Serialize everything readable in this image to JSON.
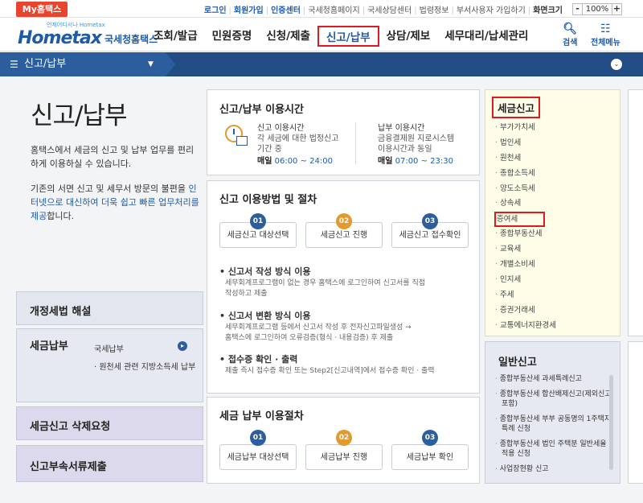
{
  "util": {
    "my_tab": "My홈택스",
    "links_blue": [
      "로그인",
      "회원가입",
      "인증센터"
    ],
    "links": [
      "국세청홈페이지",
      "국세상담센터",
      "법령정보",
      "부서사용자 가입하기",
      "화면크기"
    ],
    "zoom_minus": "-",
    "zoom_value": "100%",
    "zoom_plus": "+"
  },
  "header": {
    "logo_sub": "언제어디서나 Hometax",
    "logo_text": "Hometax",
    "agency": "국세청홈택스",
    "nav": [
      "조회/발급",
      "민원증명",
      "신청/제출",
      "신고/납부",
      "상담/제보",
      "세무대리/납세관리"
    ],
    "active_index": 3,
    "search_label": "검색",
    "menu_label": "전체메뉴"
  },
  "location": {
    "current": "신고/납부"
  },
  "page": {
    "title": "신고/납부",
    "desc1": "홈택스에서 세금의 신고 및 납부 업무를 편리하게 이용하실 수 있습니다.",
    "desc2_pre": "기존의 서면 신고 및 세무서 방문의 불편을 ",
    "desc2_hl": "인터넷으로 대신하여 더욱 쉽고 빠른 업무처리를 제공",
    "desc2_post": "합니다."
  },
  "left_boxes": {
    "law": "개정세법 해설",
    "pay": "세금납부",
    "pay_sub1": "국세납부",
    "pay_sub2": "· 원천세 관련 지방소득세 납부",
    "delete": "세금신고 삭제요청",
    "docs": "신고부속서류제출"
  },
  "hours": {
    "title": "신고/납부 이용시간",
    "a_head": "신고 이용시간",
    "a_desc1": "각 세금에 대한 법정신고",
    "a_desc2": "기간 중",
    "a_day": "매일",
    "a_time": "06:00 ~ 24:00",
    "b_head": "납부 이용시간",
    "b_desc1": "금융결제원 지로시스템",
    "b_desc2": "이용시간과 동일",
    "b_day": "매일",
    "b_time": "07:00 ~ 23:30"
  },
  "method": {
    "title": "신고 이용방법 및 절차",
    "steps": [
      {
        "num": "01",
        "label": "세금신고 대상선택"
      },
      {
        "num": "02",
        "label": "세금신고 진행"
      },
      {
        "num": "03",
        "label": "세금신고 접수확인"
      }
    ],
    "b1_title": "신고서 작성 방식 이용",
    "b1_d1": "세무회계프로그램이 없는 경우 홈택스에 로그인하여 신고서를 직접",
    "b1_d2": "작성하고 제출",
    "b2_title": "신고서 변환 방식 이용",
    "b2_d1": "세무회계프로그램 등에서 신고서 작성 후 전자신고파일생성 →",
    "b2_d2": "홈택스에 로그인하여 오류검증(형식 · 내용검증) 후 제출",
    "b3_title": "접수증 확인 · 출력",
    "b3_d1": "제출 즉시 접수증 확인 또는 Step2[신고내역]에서 접수증 확인 · 출력"
  },
  "payment": {
    "title": "세금 납부 이용절차",
    "steps": [
      {
        "num": "01",
        "label": "세금납부 대상선택"
      },
      {
        "num": "02",
        "label": "세금납부 진행"
      },
      {
        "num": "03",
        "label": "세금납부 확인"
      }
    ]
  },
  "tax_filing": {
    "title": "세금신고",
    "items": [
      "부가가치세",
      "법인세",
      "원천세",
      "종합소득세",
      "양도소득세",
      "상속세",
      "증여세",
      "종합부동산세",
      "교육세",
      "개별소비세",
      "인지세",
      "주세",
      "증권거래세",
      "교통에너지환경세"
    ],
    "highlight_index": 6
  },
  "general": {
    "title": "일반신고",
    "items": [
      "종합부동산세 과세특례신고",
      "종합부동산세 합산배제신고(제외신고 포함)",
      "종합부동산세 부부 공동명의 1주택자 특례 신청",
      "종합부동산세 법인 주택분 일반세율 적용 신청",
      "사업장현황 신고"
    ]
  },
  "colors": {
    "accent": "#1f5aa6",
    "nav_bar": "#214c84",
    "highlight": "#e0181f",
    "orange": "#e39a2c"
  }
}
